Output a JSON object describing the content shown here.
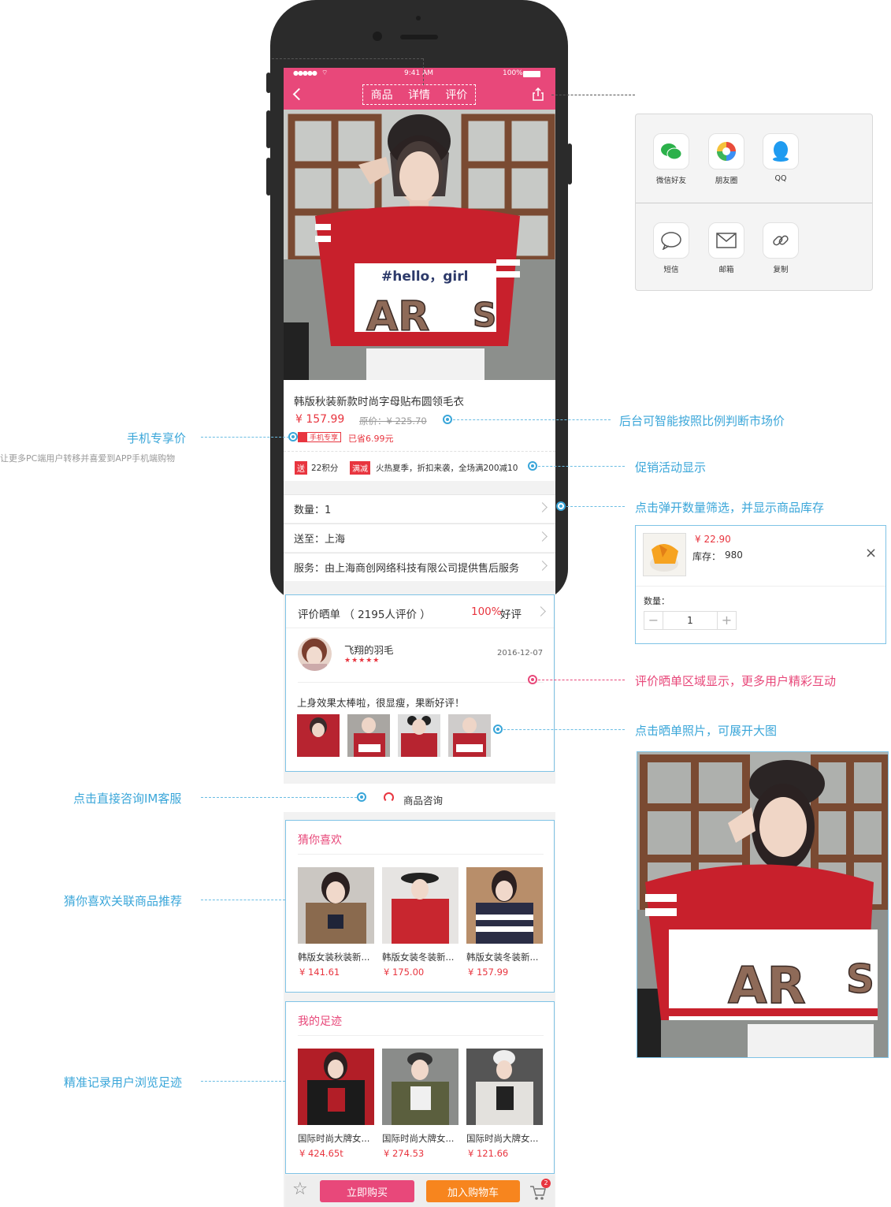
{
  "status_bar": {
    "time": "9:41 AM",
    "battery": "100%"
  },
  "nav": {
    "tabs": [
      "商品",
      "详情",
      "评价"
    ]
  },
  "hero_text": "#hello，girl",
  "product": {
    "title": "韩版秋装新款时尚字母贴布圆领毛衣",
    "price": "¥ 157.99",
    "original_price": "原价：¥ 225.70",
    "mobile_tag": "手机专享",
    "saved": "已省6.99元",
    "promo_tag1": "送",
    "promo_text1": "22积分",
    "promo_tag2": "满减",
    "promo_text2": "火热夏季，折扣来袭，全场满200减10"
  },
  "rows": {
    "quantity": "数量：1",
    "ship_to": "送至：上海",
    "service": "服务：由上海商创网络科技有限公司提供售后服务"
  },
  "reviews": {
    "header": "评价晒单 （ 2195人评价 ）",
    "rate": "100%",
    "rate_label": "好评",
    "user": "飞翔的羽毛",
    "stars": "★★★★★",
    "date": "2016-12-07",
    "content": "上身效果太棒啦，很显瘦，果断好评！"
  },
  "consult": {
    "label": "商品咨询"
  },
  "guess": {
    "title": "猜你喜欢",
    "items": [
      {
        "name": "韩版女装秋装新...",
        "price": "¥ 141.61",
        "color": "#8a6a4e"
      },
      {
        "name": "韩版女装冬装新...",
        "price": "¥ 175.00",
        "color": "#c8262f"
      },
      {
        "name": "韩版女装冬装新...",
        "price": "¥ 157.99",
        "color": "#2a2d45"
      }
    ]
  },
  "footprint": {
    "title": "我的足迹",
    "items": [
      {
        "name": "国际时尚大牌女...",
        "price": "¥ 424.65t",
        "color": "#b21e27"
      },
      {
        "name": "国际时尚大牌女...",
        "price": "¥ 274.53",
        "color": "#5b5f3e"
      },
      {
        "name": "国际时尚大牌女...",
        "price": "¥ 121.66",
        "color": "#e3e1dd"
      }
    ]
  },
  "bottom_bar": {
    "buy": "立即购买",
    "cart": "加入购物车",
    "cart_count": "2"
  },
  "share": {
    "items": [
      {
        "label": "微信好友",
        "icon": "wechat-icon"
      },
      {
        "label": "朋友圈",
        "icon": "moments-icon"
      },
      {
        "label": "QQ",
        "icon": "qq-icon"
      },
      {
        "label": "短信",
        "icon": "sms-icon"
      },
      {
        "label": "邮箱",
        "icon": "mail-icon"
      },
      {
        "label": "复制",
        "icon": "link-icon"
      }
    ]
  },
  "stock_popup": {
    "price": "¥ 22.90",
    "stock_label": "库存：",
    "stock": "980",
    "qty_label": "数量：",
    "qty": "1"
  },
  "annotations": {
    "mobile_price": "手机专享价",
    "mobile_price_sub": "让更多PC端用户转移并喜爱到APP手机端购物",
    "smart_price": "后台可智能按照比例判断市场价",
    "promo": "促销活动显示",
    "qty_popup": "点击弹开数量筛选，并显示商品库存",
    "reviews": "评价晒单区域显示，更多用户精彩互动",
    "photo": "点击晒单照片，可展开大图",
    "im": "点击直接咨询IM客服",
    "guess": "猜你喜欢关联商品推荐",
    "footprint": "精准记录用户浏览足迹"
  },
  "colors": {
    "brand": "#e8487a",
    "price": "#e8353f",
    "annotation": "#3aa6d9",
    "cart_button": "#f7851e"
  }
}
